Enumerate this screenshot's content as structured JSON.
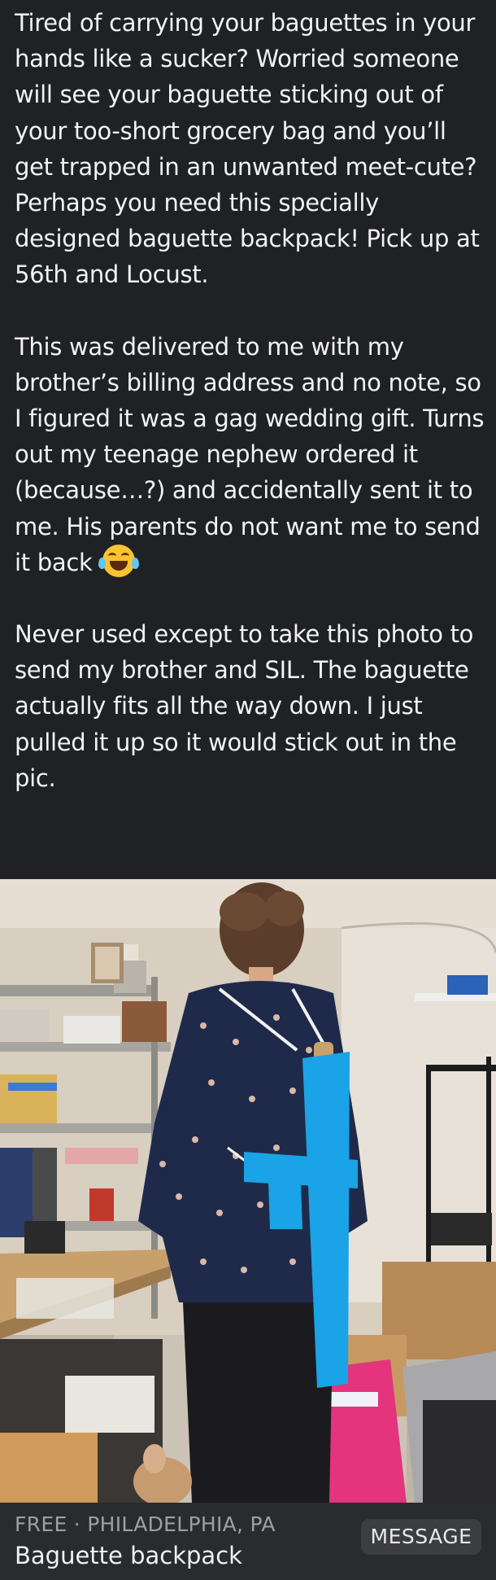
{
  "post": {
    "paragraphs": [
      "Tired of carrying your baguettes in your hands like a sucker?  Worried someone will see your baguette sticking out of your too-short grocery bag and you’ll get trapped in an unwanted meet-cute?  Perhaps you need this specially designed baguette backpack!  Pick up at 56th and Locust.",
      "This was delivered to me with my brother’s billing address and no note, so I figured it was a gag wedding gift.  Turns out my teenage nephew ordered it (because…?) and accidentally sent it to me.  His parents do not want me to send it back",
      "Never used except to take this photo to send my brother and SIL.  The baguette actually fits all the way down.  I just pulled it up so it would stick out in the pic."
    ],
    "emoji_icon": "face-with-tears-of-joy-icon"
  },
  "photo": {
    "colors": {
      "wall": "#d6cdbf",
      "shirt": "#1f2a4a",
      "bag": "#1aa3e6",
      "pants": "#1b1b1f",
      "bin": "#e8327a",
      "shelf": "#b08a5a"
    }
  },
  "listing": {
    "meta": "FREE · PHILADELPHIA, PA",
    "title": "Baguette backpack",
    "message_label": "MESSAGE"
  }
}
